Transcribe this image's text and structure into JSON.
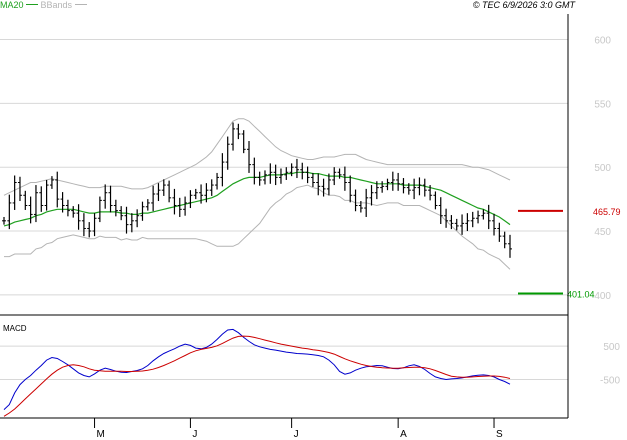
{
  "legend": {
    "ma_label": "MA20",
    "ma_color": "#1fa01f",
    "bb_label": "BBands",
    "bb_color": "#b4b4b4"
  },
  "copyright": "© TEC 6/9/2026 3:0 GMT",
  "colors": {
    "price_bars": "#000000",
    "resistance": "#cc0000",
    "support": "#009900",
    "macd_line": "#0000cc",
    "signal_line": "#cc0000",
    "grid": "#d8d8d8",
    "frame": "#000000"
  },
  "chart_data": [
    {
      "type": "ohlc",
      "panel": "price",
      "ylim": [
        385,
        620
      ],
      "yticks": [
        400,
        450,
        500,
        550,
        600
      ],
      "ytick_labels": [
        "400",
        "450",
        "500",
        "550",
        "600"
      ],
      "x_months": [
        {
          "label": "M",
          "bar_index": 17
        },
        {
          "label": "J",
          "bar_index": 35
        },
        {
          "label": "J",
          "bar_index": 54
        },
        {
          "label": "A",
          "bar_index": 74
        },
        {
          "label": "S",
          "bar_index": 92
        }
      ],
      "close": [
        458,
        472,
        488,
        478,
        470,
        463,
        480,
        470,
        486,
        490,
        475,
        470,
        466,
        464,
        458,
        452,
        450,
        460,
        474,
        480,
        470,
        466,
        462,
        455,
        458,
        462,
        469,
        472,
        479,
        482,
        486,
        476,
        470,
        467,
        472,
        478,
        480,
        478,
        482,
        486,
        492,
        504,
        518,
        530,
        526,
        514,
        502,
        492,
        490,
        494,
        496,
        492,
        494,
        496,
        500,
        498,
        496,
        492,
        488,
        485,
        483,
        490,
        496,
        494,
        488,
        478,
        470,
        468,
        476,
        480,
        484,
        485,
        488,
        490,
        487,
        484,
        482,
        484,
        486,
        482,
        478,
        470,
        462,
        458,
        456,
        454,
        456,
        458,
        460,
        462,
        464,
        458,
        452,
        446,
        440,
        436
      ],
      "ma20": [
        454,
        455,
        457,
        458,
        459,
        460,
        462,
        463,
        465,
        466,
        467,
        467,
        467,
        467,
        466,
        465,
        464,
        464,
        465,
        465,
        465,
        465,
        464,
        464,
        463,
        463,
        464,
        464,
        465,
        466,
        467,
        468,
        469,
        470,
        471,
        472,
        473,
        474,
        475,
        476,
        478,
        481,
        484,
        487,
        489,
        491,
        492,
        492,
        492,
        493,
        494,
        494,
        494,
        495,
        495,
        496,
        496,
        496,
        495,
        495,
        494,
        493,
        493,
        493,
        492,
        492,
        491,
        490,
        489,
        488,
        487,
        487,
        487,
        487,
        487,
        486,
        486,
        486,
        486,
        485,
        484,
        483,
        482,
        480,
        478,
        476,
        474,
        472,
        470,
        468,
        467,
        465,
        463,
        461,
        458,
        455
      ],
      "bb_upper": [
        478,
        480,
        482,
        484,
        486,
        488,
        488,
        489,
        490,
        491,
        490,
        489,
        488,
        487,
        486,
        485,
        484,
        484,
        484,
        485,
        485,
        485,
        485,
        484,
        483,
        483,
        483,
        484,
        486,
        488,
        490,
        492,
        494,
        496,
        498,
        500,
        502,
        505,
        508,
        512,
        518,
        524,
        530,
        536,
        538,
        538,
        536,
        532,
        528,
        524,
        520,
        516,
        513,
        511,
        509,
        508,
        507,
        506,
        506,
        507,
        508,
        508,
        508,
        509,
        510,
        510,
        510,
        508,
        506,
        505,
        504,
        503,
        502,
        502,
        502,
        502,
        502,
        502,
        502,
        502,
        502,
        502,
        502,
        502,
        502,
        502,
        502,
        501,
        500,
        500,
        499,
        498,
        496,
        494,
        492,
        490
      ],
      "bb_lower": [
        430,
        430,
        432,
        432,
        432,
        432,
        436,
        437,
        440,
        441,
        444,
        445,
        446,
        447,
        446,
        445,
        444,
        444,
        446,
        445,
        445,
        445,
        443,
        444,
        443,
        443,
        445,
        444,
        444,
        444,
        444,
        444,
        444,
        444,
        444,
        444,
        444,
        443,
        442,
        440,
        438,
        438,
        438,
        438,
        440,
        444,
        448,
        452,
        456,
        462,
        468,
        472,
        475,
        479,
        481,
        484,
        485,
        486,
        484,
        483,
        480,
        478,
        478,
        477,
        474,
        474,
        472,
        472,
        472,
        471,
        470,
        471,
        472,
        472,
        472,
        470,
        470,
        470,
        470,
        468,
        466,
        464,
        462,
        458,
        454,
        450,
        446,
        443,
        440,
        436,
        435,
        432,
        430,
        428,
        424,
        420
      ],
      "resistance": {
        "value": 465.79,
        "label": "465.79"
      },
      "support": {
        "value": 401.04,
        "label": "401.04"
      }
    },
    {
      "type": "line",
      "panel": "macd",
      "title": "MACD",
      "ylim": [
        -1650,
        1400
      ],
      "yticks": [
        500,
        -500
      ],
      "ytick_labels": [
        "500",
        "-500"
      ],
      "series": [
        {
          "values": [
            -1400,
            -1250,
            -900,
            -650,
            -500,
            -380,
            -220,
            -80,
            80,
            160,
            130,
            40,
            -60,
            -180,
            -300,
            -380,
            -420,
            -330,
            -220,
            -160,
            -200,
            -250,
            -280,
            -290,
            -260,
            -230,
            -180,
            -80,
            60,
            180,
            280,
            350,
            420,
            500,
            560,
            520,
            440,
            420,
            460,
            560,
            700,
            860,
            980,
            1000,
            900,
            760,
            640,
            540,
            480,
            440,
            400,
            380,
            350,
            320,
            300,
            280,
            270,
            260,
            240,
            220,
            180,
            80,
            -60,
            -260,
            -340,
            -300,
            -220,
            -160,
            -120,
            -100,
            -80,
            -90,
            -130,
            -170,
            -180,
            -150,
            -90,
            -60,
            -110,
            -200,
            -320,
            -420,
            -470,
            -500,
            -480,
            -470,
            -450,
            -420,
            -390,
            -370,
            -360,
            -380,
            -420,
            -500,
            -560,
            -640
          ]
        },
        {
          "values": [
            -1600,
            -1500,
            -1380,
            -1230,
            -1080,
            -930,
            -780,
            -630,
            -480,
            -340,
            -220,
            -130,
            -80,
            -60,
            -80,
            -120,
            -180,
            -220,
            -240,
            -250,
            -250,
            -250,
            -255,
            -260,
            -260,
            -255,
            -245,
            -225,
            -190,
            -140,
            -80,
            -10,
            60,
            140,
            220,
            300,
            360,
            400,
            430,
            460,
            510,
            580,
            660,
            740,
            790,
            800,
            790,
            760,
            720,
            680,
            640,
            600,
            560,
            530,
            500,
            470,
            440,
            420,
            390,
            370,
            340,
            310,
            260,
            190,
            120,
            60,
            10,
            -40,
            -80,
            -110,
            -130,
            -145,
            -155,
            -160,
            -160,
            -150,
            -140,
            -130,
            -130,
            -145,
            -180,
            -230,
            -290,
            -350,
            -400,
            -420,
            -430,
            -430,
            -420,
            -410,
            -400,
            -395,
            -395,
            -405,
            -430,
            -470
          ]
        }
      ]
    }
  ]
}
